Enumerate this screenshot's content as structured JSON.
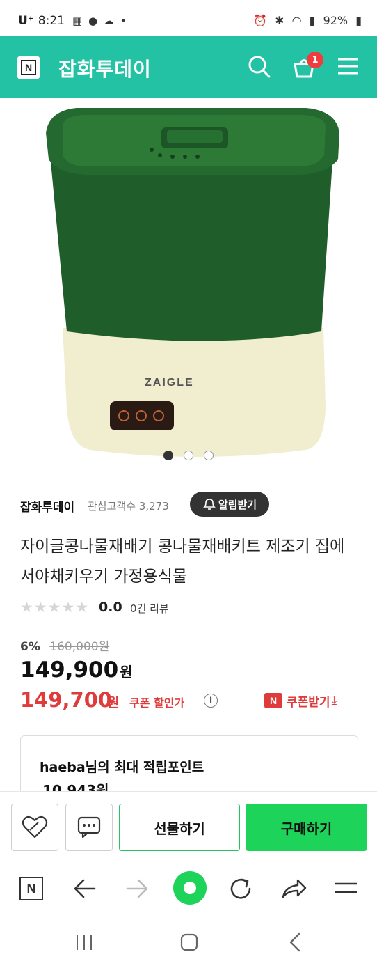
{
  "status_bar": {
    "carrier": "U⁺",
    "time": "8:21",
    "notification_icons": "▦ ● ☁ •",
    "battery": "92%"
  },
  "header": {
    "logo_letter": "N",
    "store_name": "잡화투데이",
    "cart_count": "1",
    "accent_color": "#23c2a5"
  },
  "product_image": {
    "brand_text": "ZAIGLE",
    "slides": 3,
    "active_slide": 1
  },
  "seller": {
    "name": "잡화투데이",
    "followers_label": "관심고객수",
    "followers_count": "3,273",
    "follow_button": "알림받기"
  },
  "product": {
    "title": "자이글콩나물재배기 콩나물재배키트 제조기 집에서야채키우기 가정용식물",
    "rating": "0.0",
    "review_count": "0건 리뷰",
    "discount_pct": "6%",
    "original_price": "160,000원",
    "price": "149,900",
    "price_unit": "원",
    "coupon_price": "149,700",
    "coupon_unit": "원",
    "coupon_label": "쿠폰 할인가",
    "info_symbol": "i",
    "coupon_badge": "N",
    "coupon_button": "쿠폰받기",
    "coupon_arrow": "⤓"
  },
  "points": {
    "title": "haeba님의 최대 적립포인트",
    "value": "10,943원"
  },
  "actions": {
    "gift": "선물하기",
    "buy": "구매하기"
  },
  "browser": {
    "logo_letter": "N"
  }
}
